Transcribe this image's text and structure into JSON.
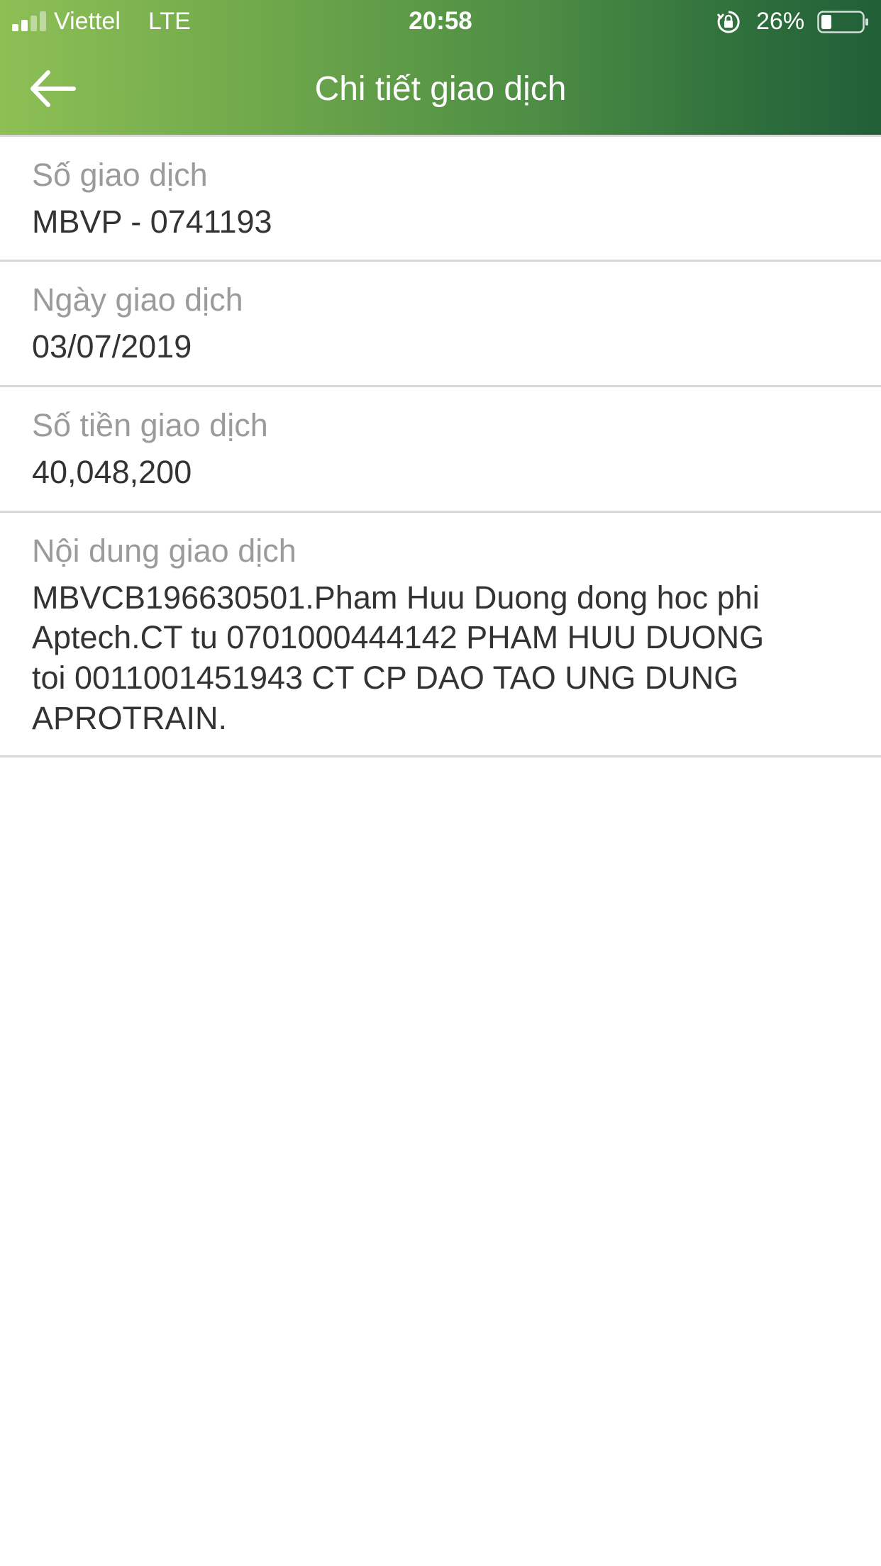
{
  "status_bar": {
    "carrier": "Viettel",
    "network": "LTE",
    "time": "20:58",
    "battery_percent": "26%",
    "battery_level": 0.26,
    "signal_bars": 2,
    "signal_bars_total": 4
  },
  "header": {
    "title": "Chi tiết giao dịch",
    "back_icon": "back-arrow-icon",
    "gradient_start": "#8dbf55",
    "gradient_end": "#215f37"
  },
  "details": {
    "number": {
      "label": "Số giao dịch",
      "value": "MBVP - 0741193"
    },
    "date": {
      "label": "Ngày giao dịch",
      "value": "03/07/2019"
    },
    "amount": {
      "label": "Số tiền giao dịch",
      "value": "40,048,200"
    },
    "content": {
      "label": "Nội dung giao dịch",
      "lines": [
        "MBVCB196630501.Pham Huu Duong dong hoc phi",
        "Aptech.CT tu 0701000444142 PHAM HUU DUONG",
        "toi 0011001451943 CT CP DAO TAO UNG DUNG",
        "APROTRAIN."
      ]
    }
  }
}
